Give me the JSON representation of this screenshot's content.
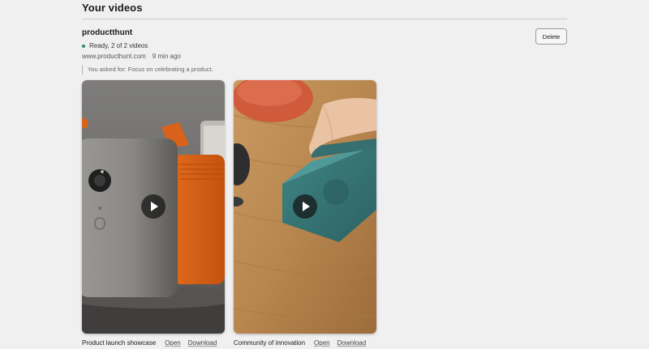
{
  "section": {
    "title": "Your videos"
  },
  "project": {
    "name": "productthunt",
    "status_text": "Ready, 2 of 2 videos",
    "status_color": "#2f8a57",
    "url": "www.producthunt.com",
    "time_ago": "9 min ago",
    "prompt_note": "You asked for: Focus on celebrating a product.",
    "delete_label": "Delete"
  },
  "videos": [
    {
      "title": "Product launch showcase",
      "open_label": "Open",
      "download_label": "Download",
      "thumbnail_icon": "play-icon"
    },
    {
      "title": "Community of innovation",
      "open_label": "Open",
      "download_label": "Download",
      "thumbnail_icon": "play-icon"
    }
  ]
}
